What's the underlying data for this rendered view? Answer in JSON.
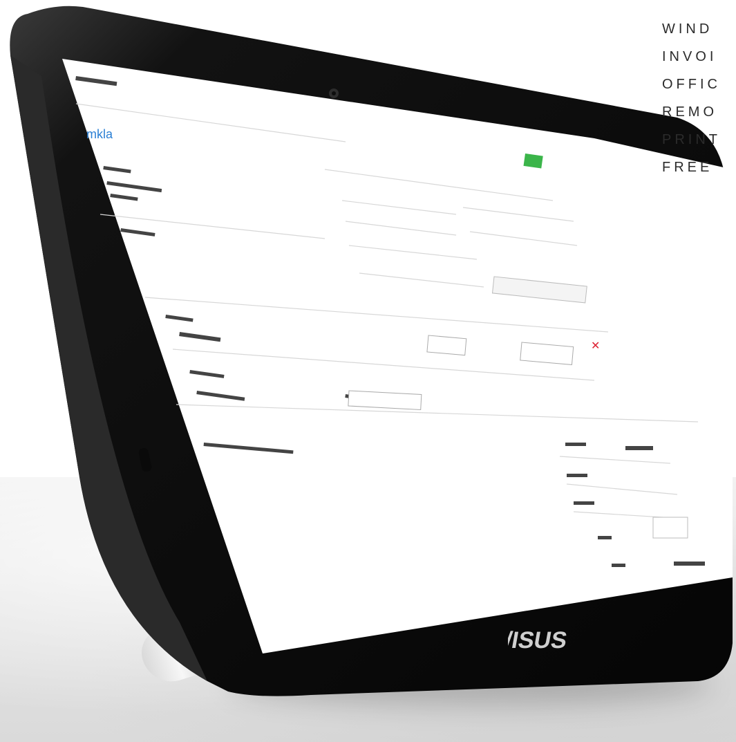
{
  "tagline": [
    "WIND",
    "INVOI",
    "OFFIC",
    "REMO",
    "PRINT",
    "FREE"
  ],
  "brand_logo": "/ISUS",
  "colors": {
    "bezel": "#111111",
    "screen": "#ffffff",
    "accent_green": "#3bb54a",
    "link_blue": "#2a7fd4",
    "tagline_text": "#2b2b2b"
  },
  "icons": [
    "camera-icon",
    "usb-port-icon",
    "asus-logo"
  ]
}
